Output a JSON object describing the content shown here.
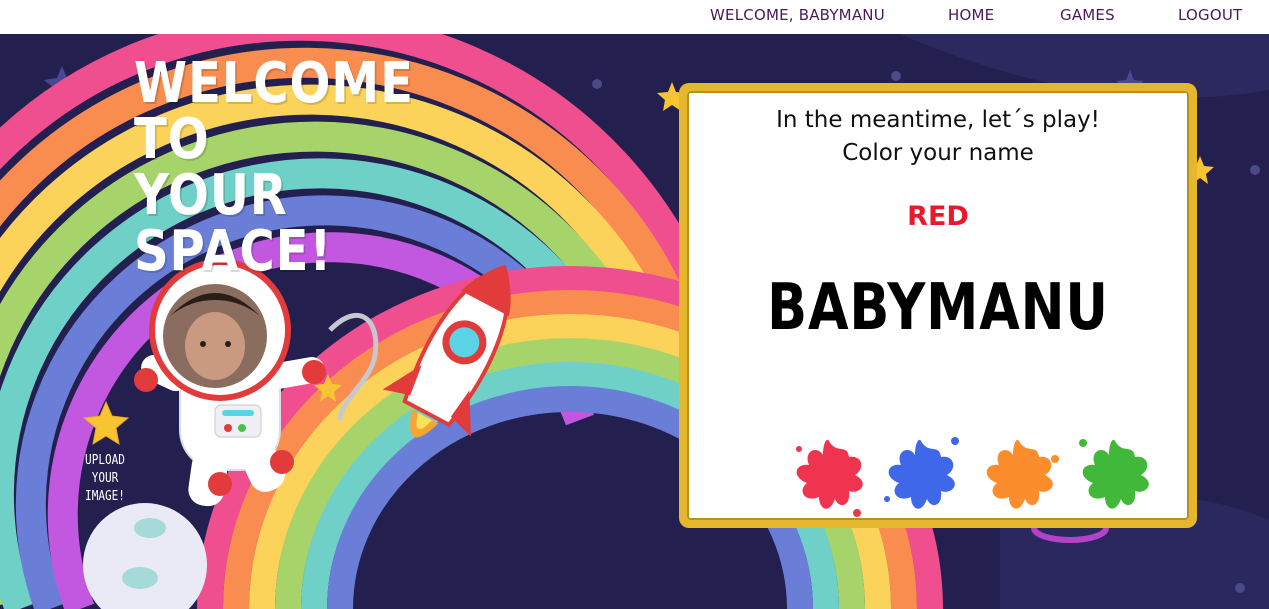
{
  "nav": {
    "welcome": "WELCOME, BABYMANU",
    "home": "HOME",
    "games": "GAMES",
    "logout": "LOGOUT"
  },
  "hero": {
    "title_line1": "WELCOME TO",
    "title_line2": "YOUR SPACE!"
  },
  "upload": {
    "label_line1": "UPLOAD",
    "label_line2": "YOUR",
    "label_line3": "IMAGE!"
  },
  "game": {
    "intro_line1": "In the meantime, let´s play!",
    "intro_line2": "Color your name",
    "selected_color": "RED",
    "player_name": "BABYMANU",
    "splats": [
      {
        "name": "red",
        "color": "#f0344f"
      },
      {
        "name": "blue",
        "color": "#3f67ea"
      },
      {
        "name": "orange",
        "color": "#fb8d2c"
      },
      {
        "name": "green",
        "color": "#42b83a"
      }
    ]
  },
  "colors": {
    "space_bg": "#23204f",
    "nav_text": "#4a1a5a",
    "panel_border": "#e5b72d",
    "selected_color": "#e8192c"
  }
}
